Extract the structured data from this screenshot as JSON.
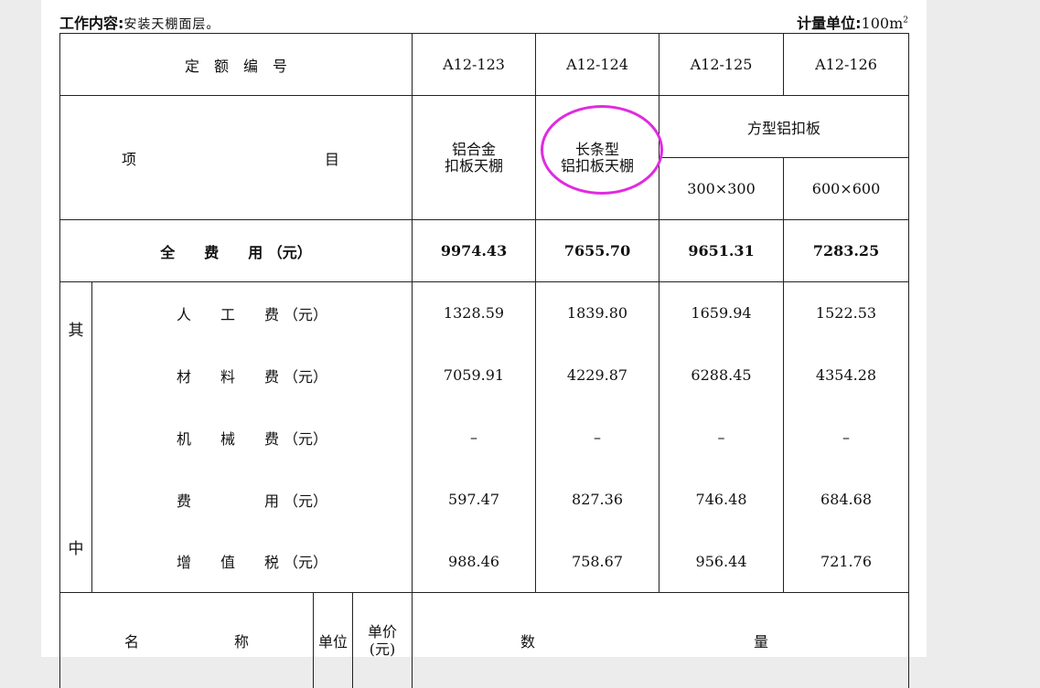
{
  "header": {
    "work_label": "工作内容:",
    "work_text": "安装天棚面层。",
    "unit_label": "计量单位:",
    "unit_value": "100m",
    "unit_sup": "2"
  },
  "table": {
    "quota_label": "定　额　编　号",
    "codes": [
      "A12-123",
      "A12-124",
      "A12-125",
      "A12-126"
    ],
    "item_label_left": "项",
    "item_label_right": "目",
    "items": {
      "col1_line1": "铝合金",
      "col1_line2": "扣板天棚",
      "col2_line1": "长条型",
      "col2_line2": "铝扣板天棚",
      "group_label": "方型铝扣板",
      "size1": "300×300",
      "size2": "600×600"
    },
    "total_label": "全　　费　　用 （元）",
    "totals": [
      "9974.43",
      "7655.70",
      "9651.31",
      "7283.25"
    ],
    "side_top": "其",
    "side_bottom": "中",
    "rows": [
      {
        "label": "人　　工　　费 （元）",
        "values": [
          "1328.59",
          "1839.80",
          "1659.94",
          "1522.53"
        ]
      },
      {
        "label": "材　　料　　费 （元）",
        "values": [
          "7059.91",
          "4229.87",
          "6288.45",
          "4354.28"
        ]
      },
      {
        "label": "机　　械　　费 （元）",
        "values": [
          "–",
          "–",
          "–",
          "–"
        ]
      },
      {
        "label": "费　　　　　用 （元）",
        "values": [
          "597.47",
          "827.36",
          "746.48",
          "684.68"
        ]
      },
      {
        "label": "增　　值　　税 （元）",
        "values": [
          "988.46",
          "758.67",
          "956.44",
          "721.76"
        ]
      }
    ],
    "bottom": {
      "name_a": "名",
      "name_b": "称",
      "unit": "单位",
      "price_line1": "单价",
      "price_line2": "(元)",
      "qty_a": "数",
      "qty_b": "量"
    }
  },
  "colors": {
    "highlight_ring": "#e02be0",
    "border": "#222222"
  }
}
